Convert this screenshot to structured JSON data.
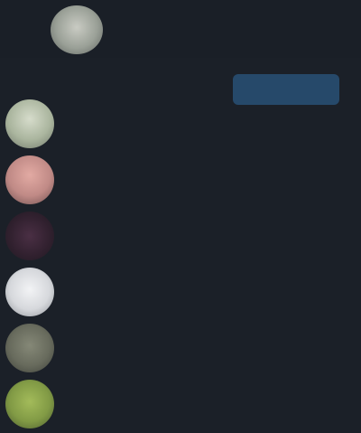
{
  "header": {
    "title": "",
    "subtitle": ""
  },
  "toolbar": {
    "label": "",
    "button_label": ""
  },
  "list": {
    "items": [
      {
        "title": "",
        "subtitle": "",
        "avatar_color": "#b9c3b1"
      },
      {
        "title": "",
        "subtitle": "",
        "avatar_color": "#c78f8b"
      },
      {
        "title": "",
        "subtitle": "",
        "avatar_color": "#3a2637"
      },
      {
        "title": "",
        "subtitle": "",
        "avatar_color": "#e4e6ea"
      },
      {
        "title": "",
        "subtitle": "",
        "avatar_color": "#6b6e5f"
      },
      {
        "title": "",
        "subtitle": "",
        "avatar_color": "#88a04a"
      }
    ]
  },
  "theme": {
    "background": "#1b2028",
    "accent": "#26496a"
  }
}
